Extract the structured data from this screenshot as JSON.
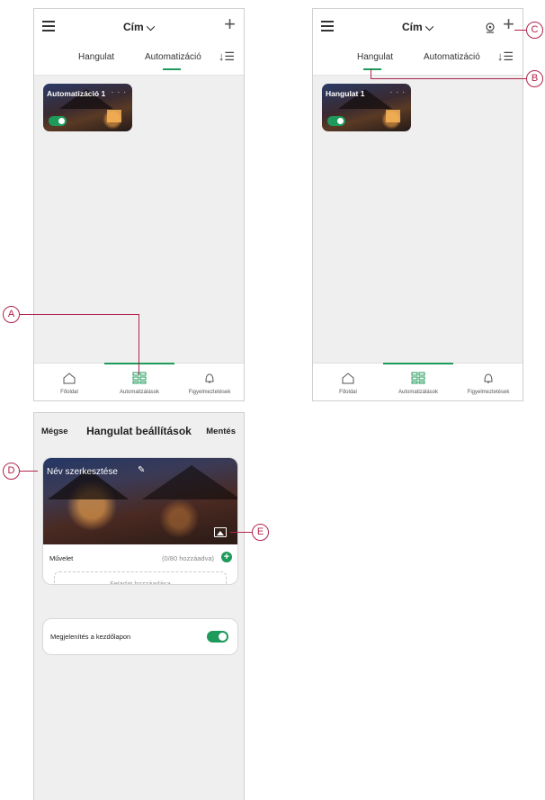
{
  "screen1": {
    "title": "Cím ⌵",
    "tabs": [
      "Hangulat",
      "Automatizáció"
    ],
    "card": {
      "title": "Automatizáció 1",
      "dots": "· · ·"
    },
    "nav": [
      "Főoldal",
      "Automatizálások",
      "Figyelmeztetések"
    ]
  },
  "screen2": {
    "title": "Cím ⌵",
    "tabs": [
      "Hangulat",
      "Automatizáció"
    ],
    "card": {
      "title": "Hangulat 1",
      "dots": "· · ·"
    },
    "nav": [
      "Főoldal",
      "Automatizálások",
      "Figyelmeztetések"
    ]
  },
  "screen3": {
    "cancel": "Mégse",
    "title": "Hangulat beállítások",
    "save": "Mentés",
    "name_edit": "Név szerkesztése",
    "action_label": "Művelet",
    "action_count": "(0/80 hozzáadva)",
    "add_task": "Feladat hozzáadása",
    "show_on_home": "Megjelenítés a kezdőlapon"
  },
  "callouts": {
    "a": "A",
    "b": "B",
    "c": "C",
    "d": "D",
    "e": "E"
  },
  "colors": {
    "accent": "#1e9a5a",
    "callout": "#b0244c"
  }
}
